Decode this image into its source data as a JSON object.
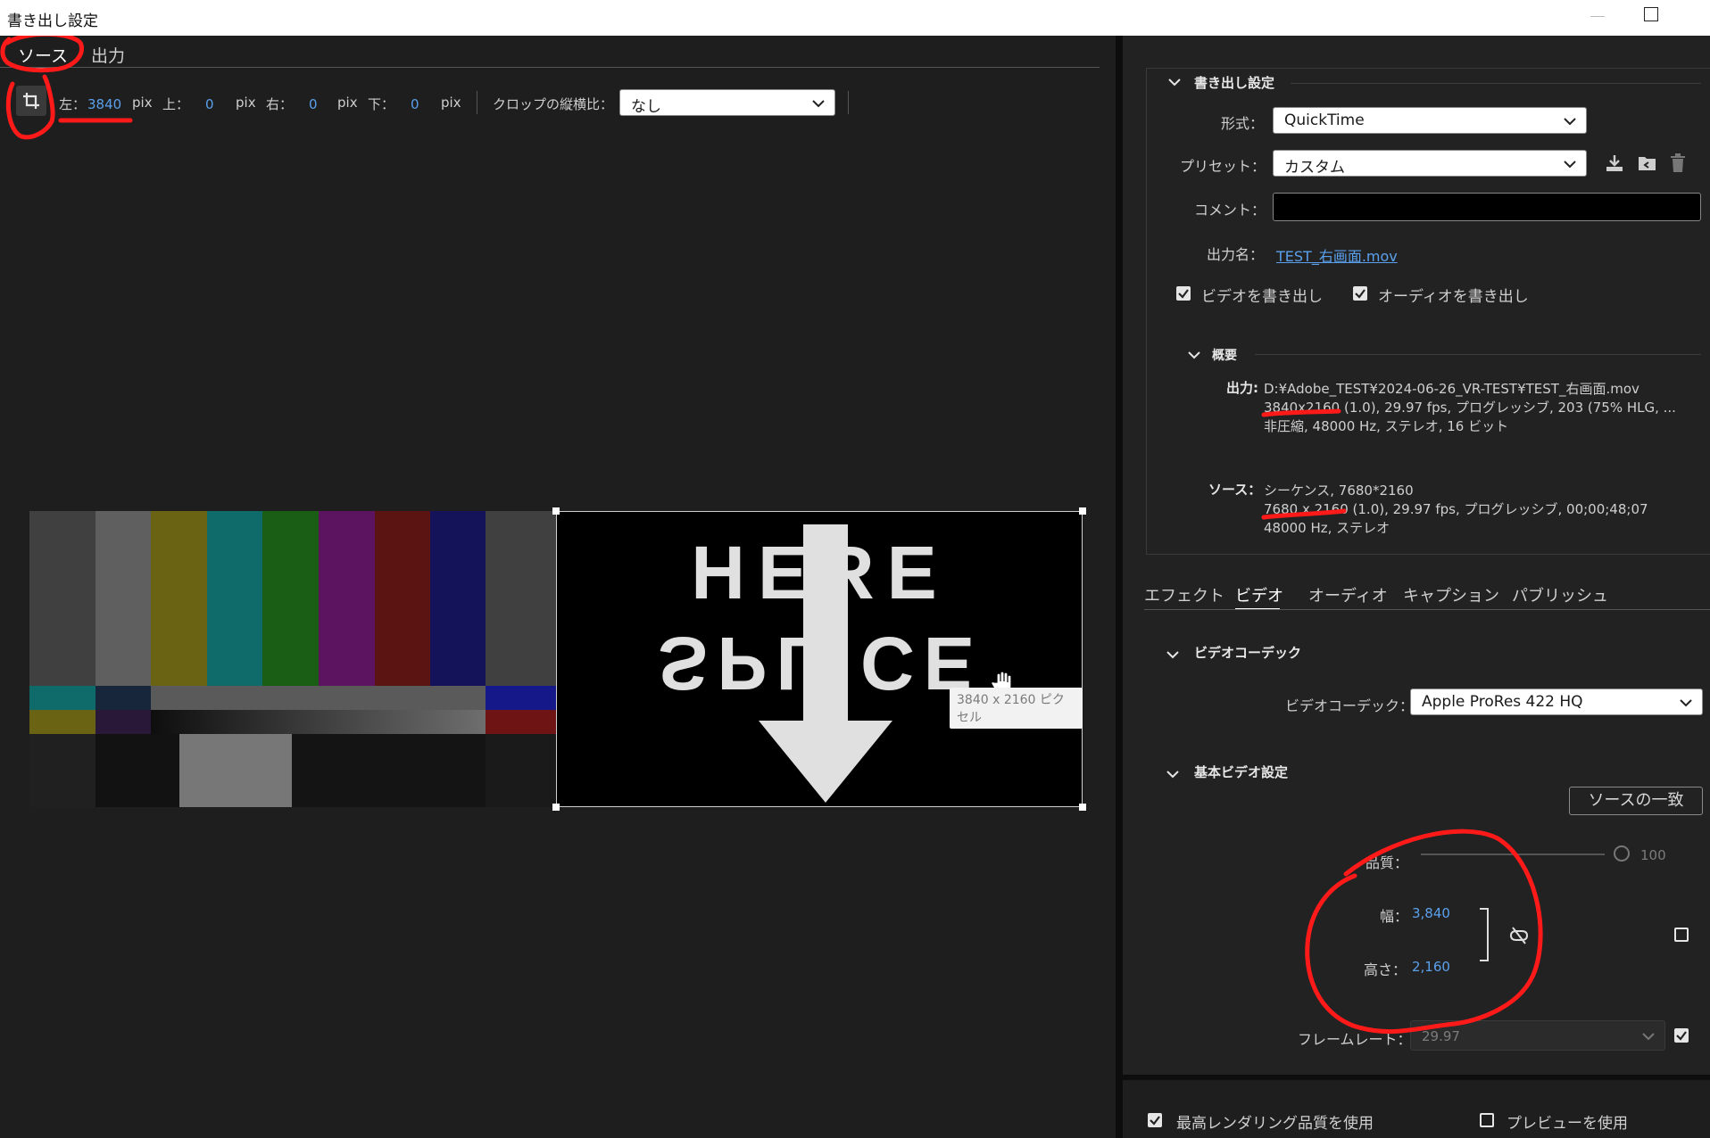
{
  "window": {
    "title": "書き出し設定"
  },
  "source_panel": {
    "tabs": [
      {
        "label": "ソース",
        "active": true
      },
      {
        "label": "出力",
        "active": false
      }
    ],
    "crop": {
      "left_label": "左：",
      "left_value": "3840",
      "unit": "pix",
      "top_label": "上：",
      "top_value": "0",
      "right_label": "右：",
      "right_value": "0",
      "bottom_label": "下：",
      "bottom_value": "0",
      "aspect_label": "クロップの縦横比：",
      "aspect_value": "なし"
    },
    "preview": {
      "splice_top_text": "HERE",
      "splice_bottom_text": "SPLICE",
      "tooltip": "3840 x 2160 ピクセル"
    }
  },
  "export_settings": {
    "section_title": "書き出し設定",
    "format_label": "形式：",
    "format_value": "QuickTime",
    "preset_label": "プリセット：",
    "preset_value": "カスタム",
    "comment_label": "コメント：",
    "comment_value": "",
    "output_name_label": "出力名：",
    "output_name_value": "TEST_右画面.mov",
    "export_video": {
      "label": "ビデオを書き出し",
      "checked": true
    },
    "export_audio": {
      "label": "オーディオを書き出し",
      "checked": true
    },
    "summary": {
      "title": "概要",
      "output_label": "出力:",
      "output_lines": [
        "D:¥Adobe_TEST¥2024-06-26_VR-TEST¥TEST_右画面.mov",
        "3840x2160 (1.0), 29.97 fps, プログレッシブ, 203 (75% HLG, ...",
        "非圧縮, 48000 Hz, ステレオ, 16 ビット"
      ],
      "source_label": "ソース：",
      "source_lines": [
        "シーケンス, 7680*2160",
        "7680 x 2160 (1.0), 29.97 fps, プログレッシブ, 00;00;48;07",
        "48000 Hz, ステレオ"
      ]
    }
  },
  "settings_tabs": [
    {
      "label": "エフェクト",
      "active": false
    },
    {
      "label": "ビデオ",
      "active": true
    },
    {
      "label": "オーディオ",
      "active": false
    },
    {
      "label": "キャプション",
      "active": false
    },
    {
      "label": "パブリッシュ",
      "active": false
    }
  ],
  "video_codec": {
    "section_title": "ビデオコーデック",
    "codec_label": "ビデオコーデック：",
    "codec_value": "Apple ProRes 422 HQ"
  },
  "basic_video": {
    "section_title": "基本ビデオ設定",
    "match_source_button": "ソースの一致",
    "quality_label": "品質：",
    "quality_value": "100",
    "width_label": "幅：",
    "width_value": "3,840",
    "height_label": "高さ：",
    "height_value": "2,160",
    "frame_rate_label": "フレームレート：",
    "frame_rate_value": "29.97"
  },
  "footer": {
    "max_render_quality": {
      "label": "最高レンダリング品質を使用",
      "checked": true
    },
    "use_previews": {
      "label": "プレビューを使用",
      "checked": false
    }
  },
  "colors": {
    "accent_blue": "#5aa0ec",
    "annotation_red": "#ff1a1a",
    "panel_bg": "#1e1e1e"
  }
}
